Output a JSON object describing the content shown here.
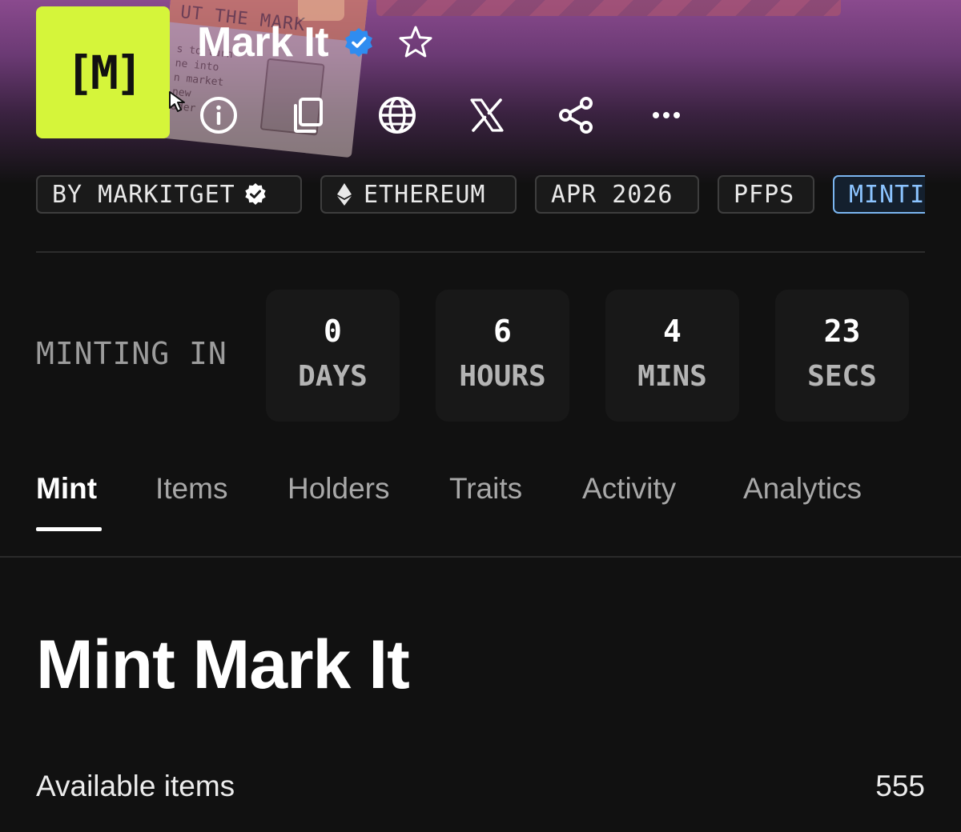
{
  "collection": {
    "name": "Mark It",
    "logo_text": "[M]",
    "accent_color": "#d5f53a"
  },
  "banner": {
    "card_title": "UT THE MARK",
    "card_lines": [
      "s to turn",
      "ne into",
      "n market",
      "new",
      "ader"
    ]
  },
  "header_icons": [
    "info-icon",
    "copy-icon",
    "globe-icon",
    "x-logo-icon",
    "share-icon",
    "more-icon"
  ],
  "tags": {
    "creator": "BY MARKITGET",
    "chain": "ETHEREUM",
    "date": "APR 2026",
    "category": "PFPS",
    "status": "MINTI"
  },
  "countdown": {
    "label": "MINTING IN",
    "days": {
      "value": "0",
      "unit": "DAYS"
    },
    "hours": {
      "value": "6",
      "unit": "HOURS"
    },
    "mins": {
      "value": "4",
      "unit": "MINS"
    },
    "secs": {
      "value": "23",
      "unit": "SECS"
    }
  },
  "tabs": [
    "Mint",
    "Items",
    "Holders",
    "Traits",
    "Activity",
    "Analytics"
  ],
  "active_tab": "Mint",
  "mint": {
    "heading": "Mint Mark It",
    "available_label": "Available items",
    "available_value": "555"
  }
}
